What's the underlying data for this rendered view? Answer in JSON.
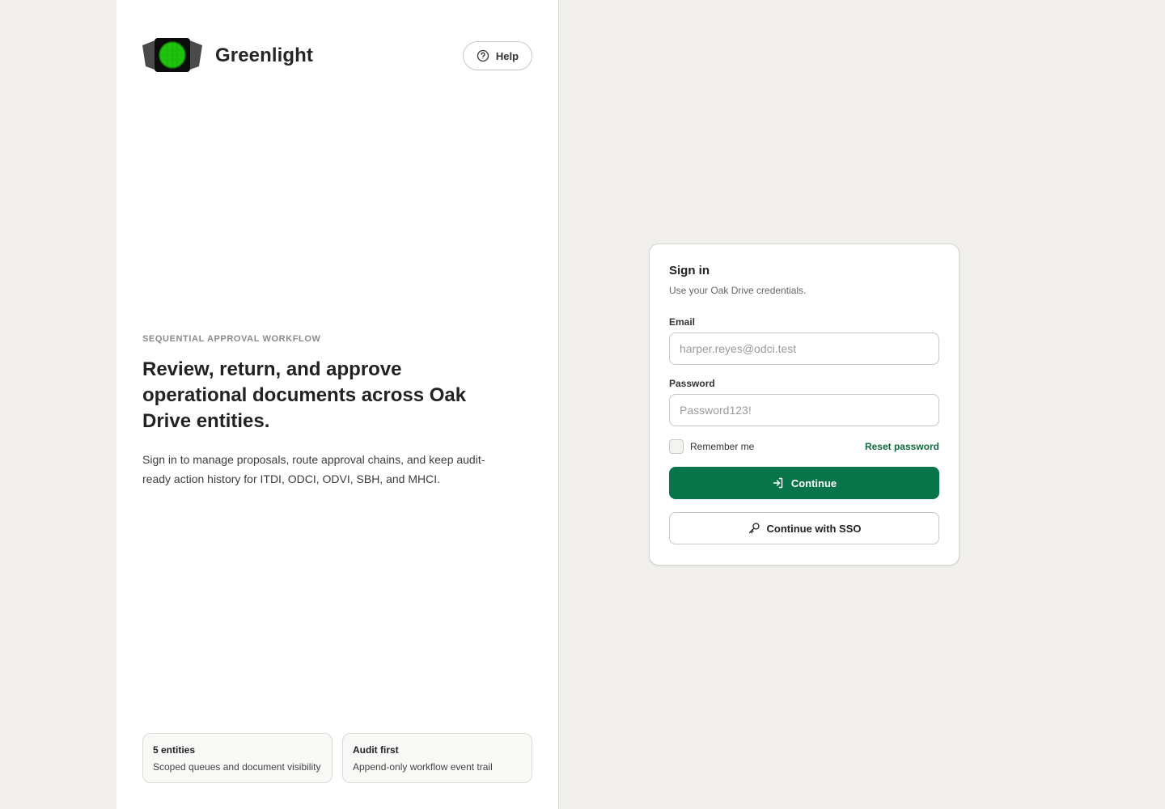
{
  "brand": {
    "name": "Greenlight",
    "logo_icon": "traffic-light-icon"
  },
  "header": {
    "help_label": "Help",
    "help_icon": "question-circle-icon"
  },
  "hero": {
    "eyebrow": "SEQUENTIAL APPROVAL WORKFLOW",
    "headline": "Review, return, and approve operational documents across Oak Drive entities.",
    "description": "Sign in to manage proposals, route approval chains, and keep audit-ready action history for ITDI, ODCI, ODVI, SBH, and MHCI."
  },
  "features": [
    {
      "title": "5 entities",
      "description": "Scoped queues and document visibility"
    },
    {
      "title": "Audit first",
      "description": "Append-only workflow event trail"
    }
  ],
  "signin": {
    "title": "Sign in",
    "subtitle": "Use your Oak Drive credentials.",
    "email_label": "Email",
    "email_placeholder": "harper.reyes@odci.test",
    "email_value": "",
    "password_label": "Password",
    "password_placeholder": "Password123!",
    "password_value": "",
    "remember_label": "Remember me",
    "remember_checked": false,
    "reset_label": "Reset password",
    "continue_label": "Continue",
    "continue_icon": "sign-in-arrow-icon",
    "sso_label": "Continue with SSO",
    "sso_icon": "key-icon"
  },
  "colors": {
    "accent": "#07744a",
    "link": "#0e6b3b",
    "background": "#f0efeb",
    "panel": "#ffffff",
    "logo_light": "#1fc20f"
  }
}
